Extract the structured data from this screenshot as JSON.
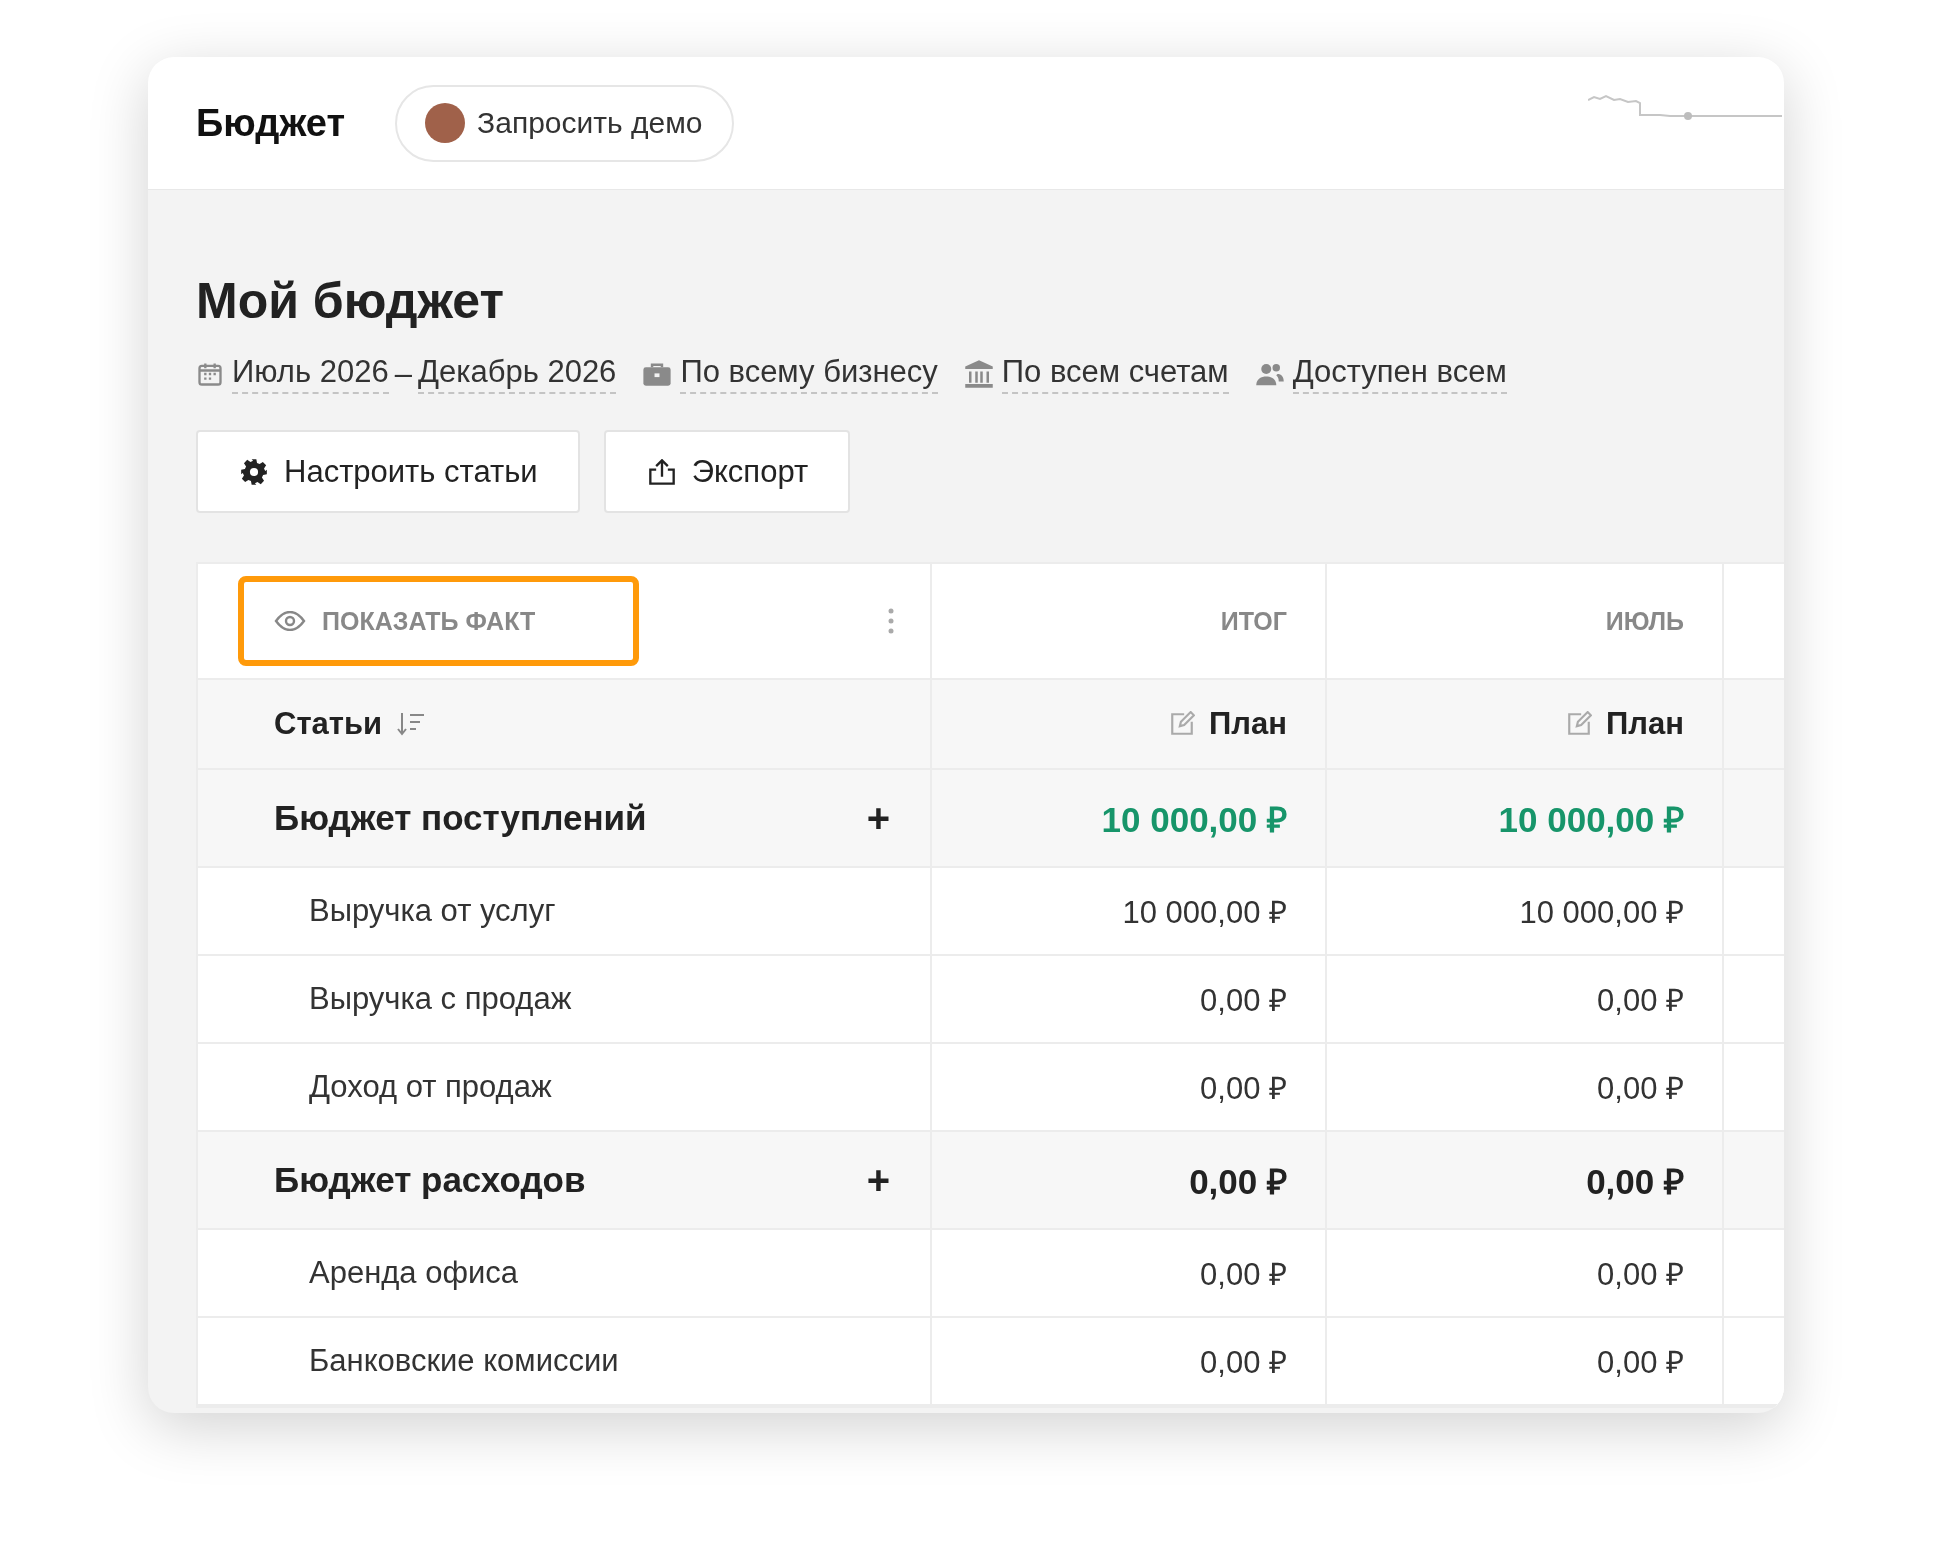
{
  "header": {
    "title": "Бюджет",
    "demo_button": "Запросить демо"
  },
  "page": {
    "title": "Мой бюджет",
    "period": {
      "from": "Июль 2026",
      "separator": "–",
      "to": "Декабрь 2026"
    },
    "filters": [
      {
        "kind": "business",
        "label": "По всему бизнесу"
      },
      {
        "kind": "accounts",
        "label": "По всем счетам"
      },
      {
        "kind": "access",
        "label": "Доступен всем"
      }
    ],
    "actions": [
      {
        "kind": "settings",
        "label": "Настроить статьи"
      },
      {
        "kind": "export",
        "label": "Экспорт"
      }
    ]
  },
  "table": {
    "show_fact": {
      "label": "ПОКАЗАТЬ ФАКТ",
      "highlighted": true
    },
    "articles_heading": "Статьи",
    "columns": [
      {
        "heading": "ИТОГ",
        "subheading": "План"
      },
      {
        "heading": "ИЮЛЬ",
        "subheading": "План"
      }
    ],
    "rows": [
      {
        "kind": "group",
        "label": "Бюджет поступлений",
        "plus": "+",
        "color": "#17956a",
        "values": [
          "10 000,00 ₽",
          "10 000,00 ₽"
        ]
      },
      {
        "kind": "item",
        "label": "Выручка от услуг",
        "values": [
          "10 000,00 ₽",
          "10 000,00 ₽"
        ]
      },
      {
        "kind": "item",
        "label": "Выручка с продаж",
        "values": [
          "0,00 ₽",
          "0,00 ₽"
        ]
      },
      {
        "kind": "item",
        "label": "Доход от продаж",
        "values": [
          "0,00 ₽",
          "0,00 ₽"
        ]
      },
      {
        "kind": "group",
        "label": "Бюджет расходов",
        "plus": "+",
        "color": "#222222",
        "values": [
          "0,00 ₽",
          "0,00 ₽"
        ]
      },
      {
        "kind": "item",
        "label": "Аренда офиса",
        "values": [
          "0,00 ₽",
          "0,00 ₽"
        ]
      },
      {
        "kind": "item",
        "label": "Банковские комиссии",
        "values": [
          "0,00 ₽",
          "0,00 ₽"
        ]
      }
    ]
  }
}
